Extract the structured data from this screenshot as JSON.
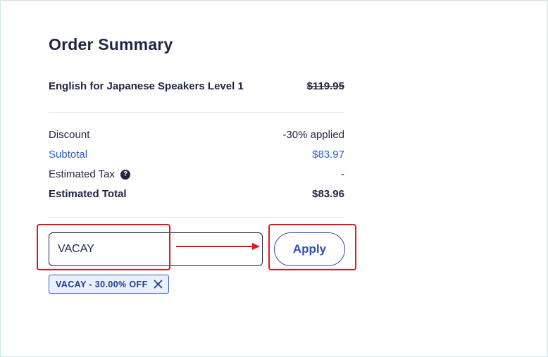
{
  "order_summary": {
    "title": "Order Summary",
    "product": {
      "name": "English for Japanese Speakers Level 1",
      "price": "$119.95"
    },
    "discount": {
      "label": "Discount",
      "value": "-30% applied"
    },
    "subtotal": {
      "label": "Subtotal",
      "value": "$83.97"
    },
    "estimated_tax": {
      "label": "Estimated Tax",
      "value": "-"
    },
    "estimated_total": {
      "label": "Estimated Total",
      "value": "$83.96"
    }
  },
  "promo": {
    "input_value": "VACAY",
    "apply_label": "Apply",
    "applied_coupon": "VACAY - 30.00% OFF"
  },
  "colors": {
    "text": "#1f2544",
    "accent": "#2d5bd0",
    "annotation": "#e0191d"
  },
  "icons": {
    "help": "question-circle-icon",
    "remove": "close-icon"
  }
}
